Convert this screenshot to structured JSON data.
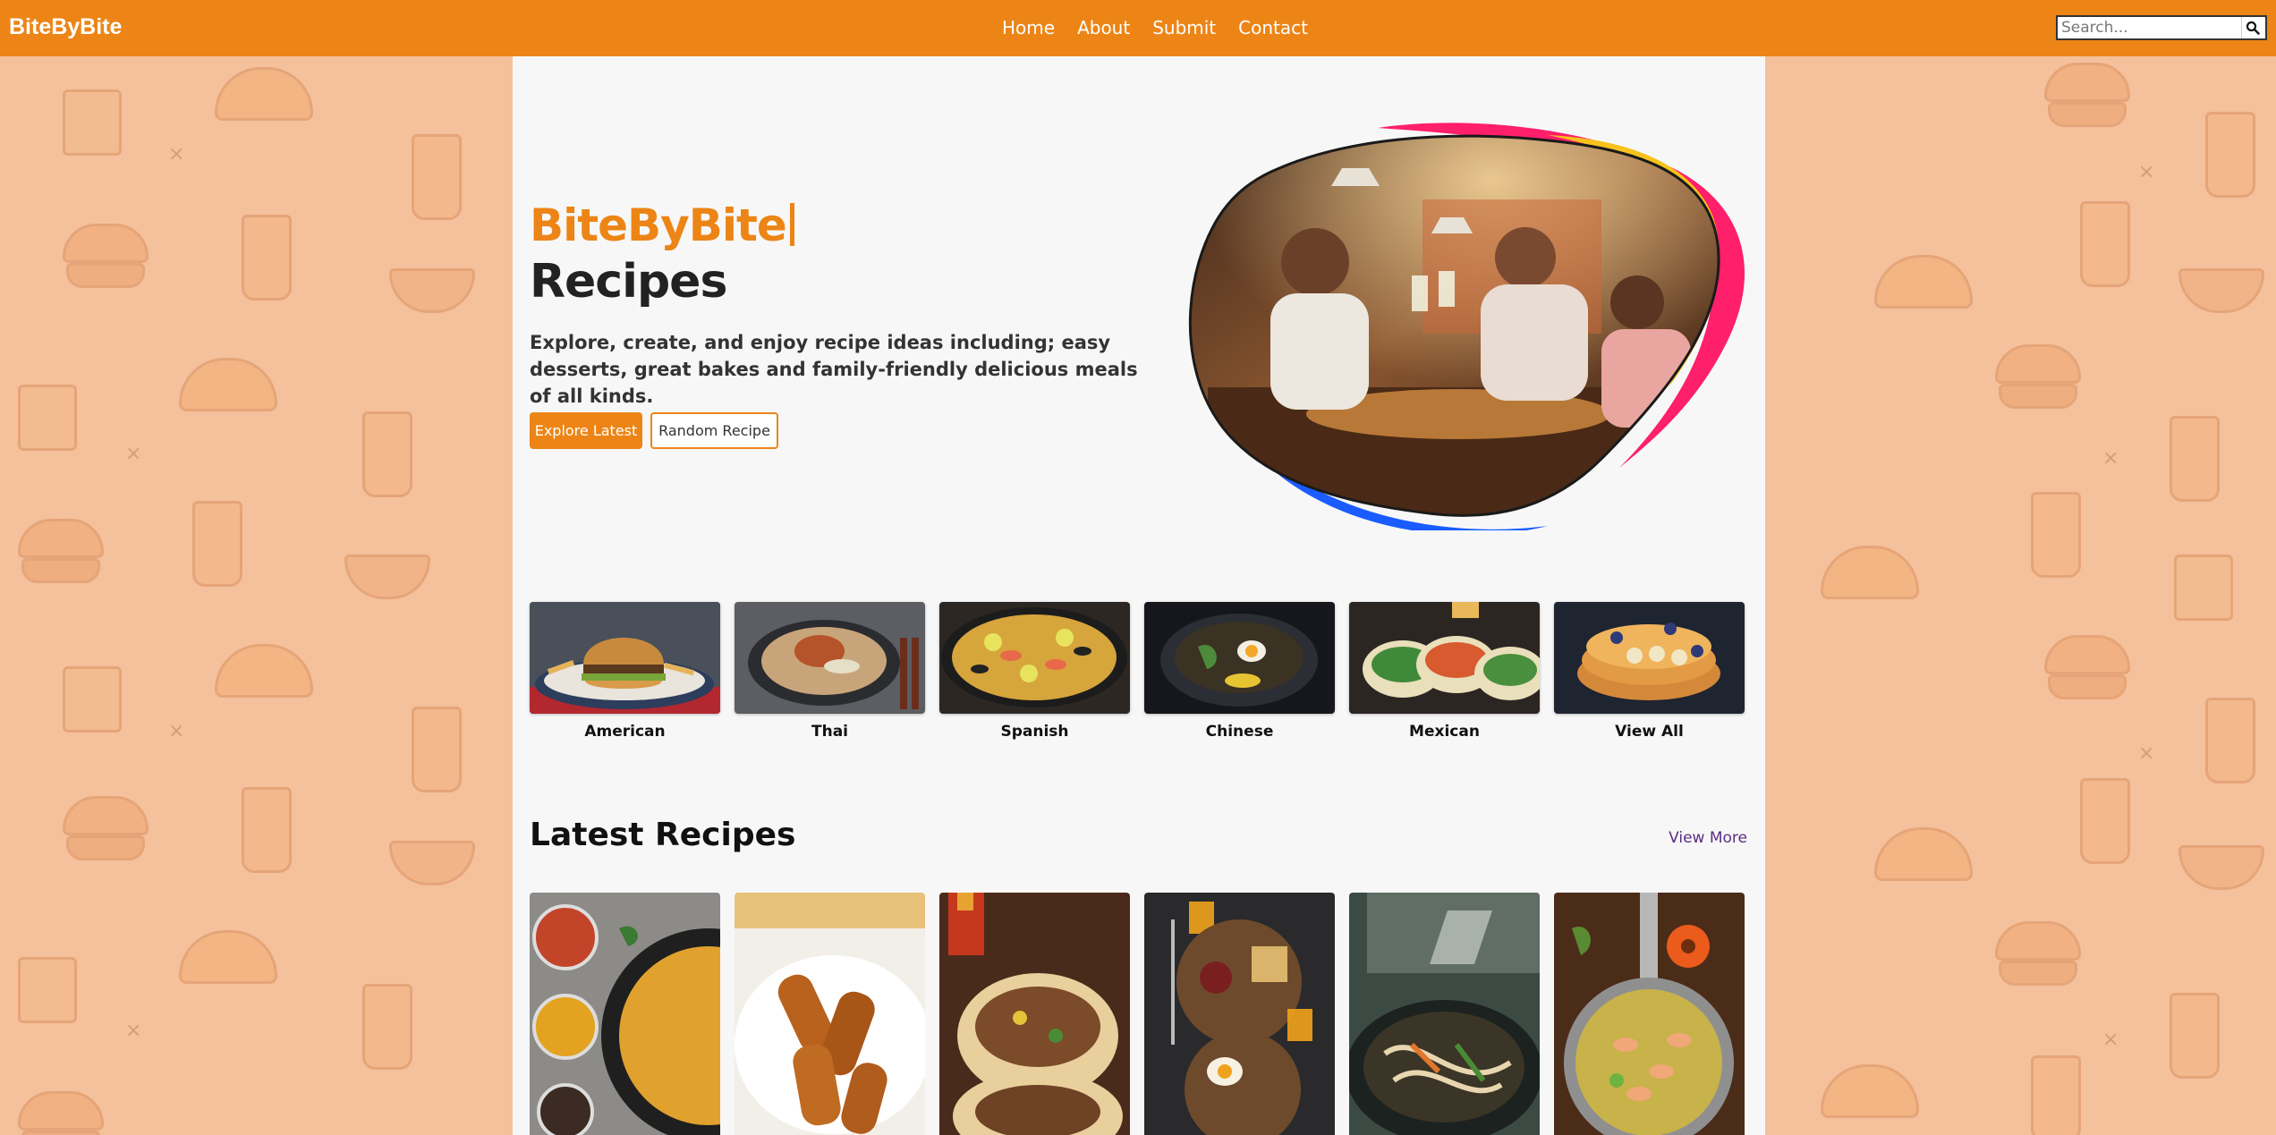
{
  "nav": {
    "brand": "BiteByBite",
    "links": [
      "Home",
      "About",
      "Submit",
      "Contact"
    ],
    "search_placeholder": "Search..."
  },
  "hero": {
    "title_accent": "BiteByBite",
    "title": "Recipes",
    "description": "Explore, create, and enjoy recipe ideas including; easy desserts, great bakes and family-friendly delicious meals of all kinds.",
    "primary_button": "Explore Latest",
    "secondary_button": "Random Recipe"
  },
  "categories": [
    {
      "label": "American"
    },
    {
      "label": "Thai"
    },
    {
      "label": "Spanish"
    },
    {
      "label": "Chinese"
    },
    {
      "label": "Mexican"
    },
    {
      "label": "View All"
    }
  ],
  "latest": {
    "title": "Latest Recipes",
    "view_more": "View More"
  },
  "colors": {
    "accent": "#ec8516",
    "background": "#f5c09c",
    "panel": "#f7f7f7",
    "link": "#5a2d82"
  }
}
